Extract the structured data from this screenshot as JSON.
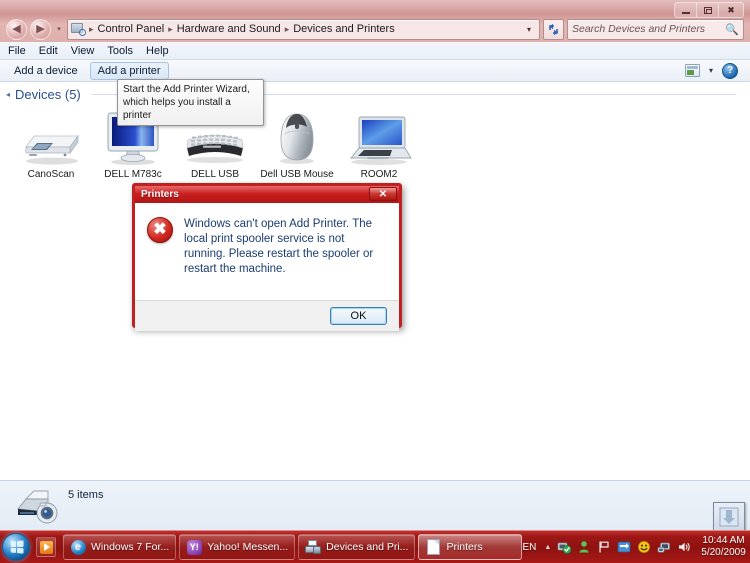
{
  "window": {
    "controls": {
      "minimize": "Minimize",
      "restore": "Restore",
      "close": "Close"
    }
  },
  "address_bar": {
    "back_label": "Back",
    "forward_label": "Forward",
    "breadcrumbs": [
      "Control Panel",
      "Hardware and Sound",
      "Devices and Printers"
    ],
    "separator": "▸",
    "dropdown": "▾",
    "refresh_label": "↻"
  },
  "search": {
    "placeholder": "Search Devices and Printers",
    "value": "",
    "icon": "search-icon"
  },
  "menu": {
    "items": [
      "File",
      "Edit",
      "View",
      "Tools",
      "Help"
    ]
  },
  "toolbar": {
    "add_device_label": "Add a device",
    "add_printer_label": "Add a printer",
    "view_options_label": "Change your view",
    "view_dropdown": "▾",
    "help_label": "?"
  },
  "tooltip": {
    "text": "Start the Add Printer Wizard, which helps you install a printer"
  },
  "main": {
    "group_title": "Devices (5)",
    "collapse_glyph": "◂",
    "devices": [
      {
        "label": "CanoScan",
        "icon": "scanner-icon"
      },
      {
        "label": "DELL M783c",
        "icon": "monitor-icon"
      },
      {
        "label": "DELL USB",
        "icon": "keyboard-icon"
      },
      {
        "label": "Dell USB Mouse",
        "icon": "mouse-icon"
      },
      {
        "label": "ROOM2",
        "icon": "laptop-icon"
      }
    ]
  },
  "status_bar": {
    "text": "5 items",
    "icon": "devices-and-printers-icon"
  },
  "download_widget": {
    "icon": "download-arrow-icon"
  },
  "dialog": {
    "title": "Printers",
    "close_label": "✕",
    "error_icon": "error-icon",
    "message": "Windows can't open Add Printer. The local print spooler service is not running. Please restart the spooler or restart the machine.",
    "ok_label": "OK"
  },
  "taskbar": {
    "start_label": "Start",
    "quick_launch": [
      {
        "label": "Windows Media Player",
        "icon": "media-player-icon"
      }
    ],
    "tasks": [
      {
        "label": "Windows 7 For...",
        "icon": "internet-explorer-icon",
        "active": false
      },
      {
        "label": "Yahoo! Messen...",
        "icon": "yahoo-messenger-icon",
        "active": false
      },
      {
        "label": "Devices and Pri...",
        "icon": "devices-printers-icon",
        "active": false
      },
      {
        "label": "Printers",
        "icon": "document-icon",
        "active": true
      }
    ],
    "tray": {
      "language": "EN",
      "chevron": "▲",
      "icons": [
        {
          "name": "action-center-icon",
          "glyph": "✔"
        },
        {
          "name": "user-icon",
          "glyph": "♟"
        },
        {
          "name": "flag-icon",
          "glyph": "⚑"
        },
        {
          "name": "network-sync-icon",
          "glyph": "⇄"
        },
        {
          "name": "messenger-smiley-icon",
          "glyph": "☺"
        },
        {
          "name": "network-icon",
          "glyph": "⌗"
        },
        {
          "name": "volume-icon",
          "glyph": "◂"
        }
      ],
      "time": "10:44 AM",
      "date": "5/20/2009"
    }
  },
  "colors": {
    "accent_red": "#c11f20",
    "taskbar_red": "#9c1715",
    "link_blue": "#2a4f8f",
    "dialog_text_blue": "#1c3c72"
  }
}
